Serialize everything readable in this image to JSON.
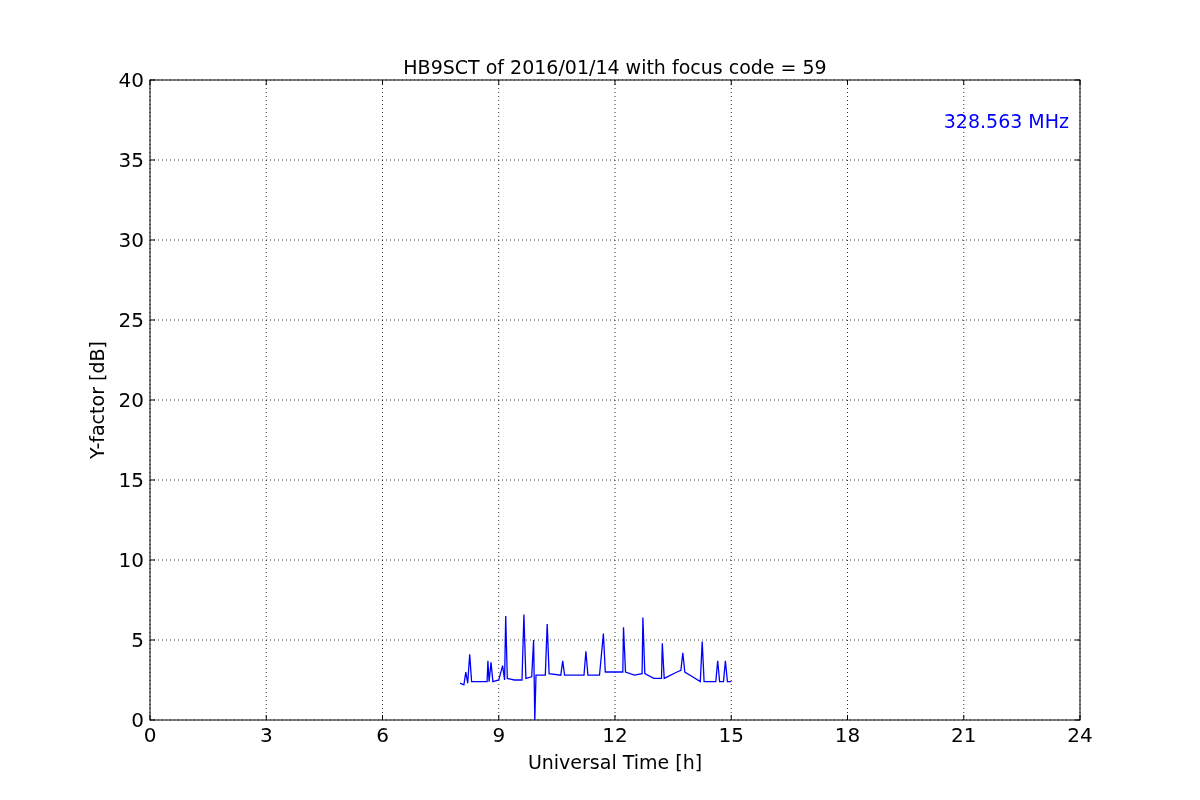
{
  "chart": {
    "chart_data": {
      "type": "line",
      "title": "HB9SCT of 2016/01/14 with focus code = 59",
      "xlabel": "Universal Time [h]",
      "ylabel": "Y-factor [dB]",
      "grid": true,
      "xlim": [
        0,
        24
      ],
      "ylim": [
        0,
        40
      ],
      "xticks": [
        0,
        3,
        6,
        9,
        12,
        15,
        18,
        21,
        24
      ],
      "yticks": [
        0,
        5,
        10,
        15,
        20,
        25,
        30,
        35,
        40
      ],
      "x": [
        8.0,
        8.1,
        8.15,
        8.2,
        8.25,
        8.3,
        8.5,
        8.7,
        8.72,
        8.75,
        8.8,
        8.85,
        9.0,
        9.1,
        9.15,
        9.18,
        9.22,
        9.4,
        9.6,
        9.65,
        9.7,
        9.85,
        9.9,
        9.93,
        9.96,
        10.2,
        10.25,
        10.3,
        10.6,
        10.65,
        10.7,
        11.0,
        11.2,
        11.25,
        11.3,
        11.6,
        11.7,
        11.75,
        12.0,
        12.2,
        12.22,
        12.27,
        12.5,
        12.7,
        12.72,
        12.77,
        13.0,
        13.2,
        13.22,
        13.27,
        13.6,
        13.7,
        13.75,
        13.8,
        14.0,
        14.2,
        14.25,
        14.3,
        14.6,
        14.65,
        14.7,
        14.8,
        14.85,
        14.9,
        15.0
      ],
      "series": [
        {
          "color": "#0000ff",
          "values": [
            2.3,
            2.2,
            3.0,
            2.3,
            4.1,
            2.4,
            2.4,
            2.4,
            3.7,
            2.4,
            3.6,
            2.4,
            2.5,
            3.4,
            2.5,
            6.5,
            2.6,
            2.5,
            2.5,
            6.6,
            2.6,
            2.7,
            5.0,
            0.0,
            2.8,
            2.8,
            6.0,
            2.9,
            2.8,
            3.7,
            2.8,
            2.8,
            2.8,
            4.3,
            2.8,
            2.8,
            5.4,
            3.0,
            3.0,
            3.0,
            5.8,
            3.0,
            2.8,
            2.9,
            6.4,
            2.9,
            2.6,
            2.6,
            4.8,
            2.6,
            3.0,
            3.1,
            4.2,
            3.0,
            2.7,
            2.4,
            4.9,
            2.4,
            2.4,
            3.7,
            2.4,
            2.4,
            3.7,
            2.4,
            2.4
          ]
        }
      ],
      "annotations": [
        {
          "text": "328.563 MHz"
        }
      ]
    }
  }
}
